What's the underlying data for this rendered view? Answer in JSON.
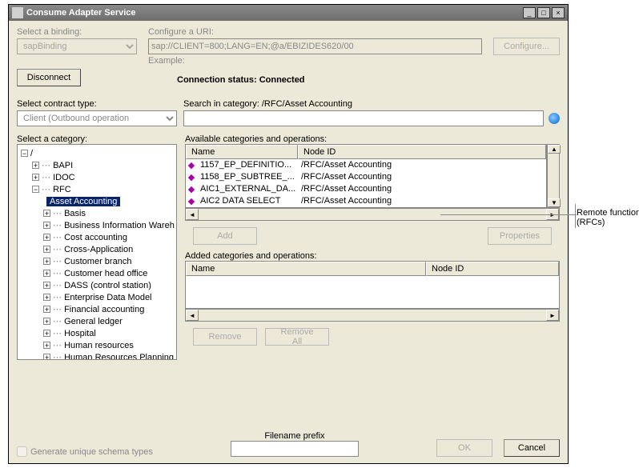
{
  "window": {
    "title": "Consume Adapter Service"
  },
  "binding": {
    "label": "Select a binding:",
    "value": "sapBinding"
  },
  "uri": {
    "label": "Configure a URI:",
    "value": "sap://CLIENT=800;LANG=EN;@a/EBIZIDES620/00",
    "example": "Example:"
  },
  "buttons": {
    "configure": "Configure...",
    "disconnect": "Disconnect",
    "add": "Add",
    "properties": "Properties",
    "remove": "Remove",
    "removeAll": "Remove All",
    "ok": "OK",
    "cancel": "Cancel"
  },
  "status": {
    "label": "Connection status:",
    "value": "Connected"
  },
  "contract": {
    "label": "Select contract type:",
    "value": "Client (Outbound operation"
  },
  "search": {
    "label": "Search in category:",
    "value": "/RFC/Asset Accounting"
  },
  "tree": {
    "label": "Select a category:",
    "root": "/",
    "top": {
      "bapi": "BAPI",
      "idoc": "IDOC",
      "rfc": "RFC"
    },
    "selected": "Asset Accounting",
    "children": [
      "Basis",
      "Business Information Wareh",
      "Cost accounting",
      "Cross-Application",
      "Customer branch",
      "Customer head office",
      "DASS (control station)",
      "Enterprise Data Model",
      "Financial accounting",
      "General ledger",
      "Hospital",
      "Human resources",
      "Human Resources Planning"
    ]
  },
  "available": {
    "label": "Available categories and operations:",
    "cols": {
      "name": "Name",
      "node": "Node ID"
    },
    "rows": [
      {
        "name": "1157_EP_DEFINITIO...",
        "node": "/RFC/Asset Accounting"
      },
      {
        "name": "1158_EP_SUBTREE_...",
        "node": "/RFC/Asset Accounting"
      },
      {
        "name": "AIC1_EXTERNAL_DA...",
        "node": "/RFC/Asset Accounting"
      },
      {
        "name": "AIC2 DATA SELECT",
        "node": "/RFC/Asset Accounting"
      }
    ]
  },
  "added": {
    "label": "Added categories and operations:",
    "cols": {
      "name": "Name",
      "node": "Node ID"
    }
  },
  "filename": {
    "label": "Filename prefix"
  },
  "checkbox": {
    "label": "Generate unique schema types"
  },
  "annotation": "Remote function calls (RFCs)"
}
